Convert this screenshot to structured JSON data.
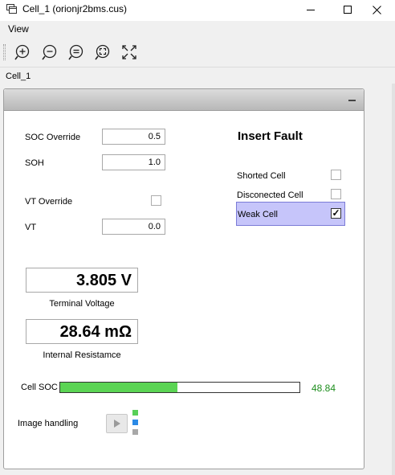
{
  "window": {
    "title": "Cell_1 (orionjr2bms.cus)"
  },
  "menu": {
    "view_label": "View"
  },
  "toolbar": {
    "icons": [
      "zoom-in-icon",
      "zoom-out-icon",
      "zoom-reset-icon",
      "zoom-fit-icon",
      "expand-icon"
    ]
  },
  "tab": {
    "label": "Cell_1"
  },
  "settings": {
    "soc_override_label": "SOC Override",
    "soc_override_value": "0.5",
    "soh_label": "SOH",
    "soh_value": "1.0",
    "vt_override_label": "VT Override",
    "vt_override_checked": false,
    "vt_label": "VT",
    "vt_value": "0.0"
  },
  "fault": {
    "title": "Insert Fault",
    "shorted_label": "Shorted Cell",
    "shorted_checked": false,
    "disconnected_label": "Disconected Cell",
    "disconnected_checked": false,
    "weak_label": "Weak Cell",
    "weak_checked": true,
    "weak_check_mark": "✓"
  },
  "readouts": {
    "terminal_voltage_value": "3.805 V",
    "terminal_voltage_label": "Terminal Voltage",
    "internal_resistance_value": "28.64 mΩ",
    "internal_resistance_label": "Internal Resistamce"
  },
  "soc": {
    "label": "Cell SOC",
    "value_text": "48.84",
    "fill_percent": 48.84,
    "fill_color": "#5bd454",
    "value_color": "#1e8e1e"
  },
  "image_handling": {
    "label": "Image handling",
    "indicator_colors": [
      "#58d058",
      "#2b8ae6",
      "#a8a8a8"
    ]
  },
  "colors": {
    "weak_row_bg": "#c6c5fa",
    "weak_row_border": "#7b7bd6"
  }
}
